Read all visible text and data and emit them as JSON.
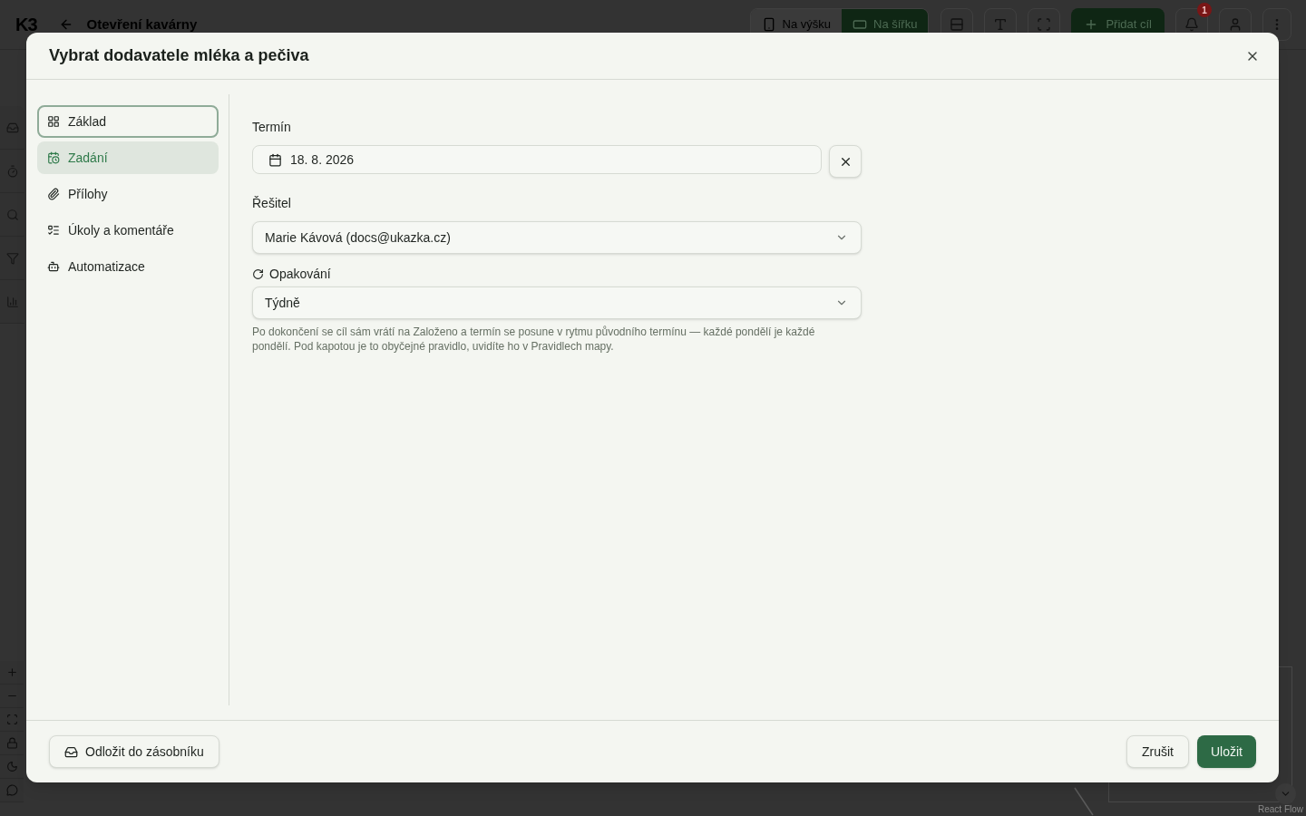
{
  "app": {
    "logo": "K3",
    "title": "Otevření kavárny",
    "orientation": [
      {
        "label": "Na výšku",
        "kind": "portrait",
        "selected": false
      },
      {
        "label": "Na šířku",
        "kind": "landscape",
        "selected": true
      }
    ],
    "add_button": "Přidat cíl",
    "notification_count": "1",
    "attribution": "React Flow"
  },
  "dialog": {
    "title": "Vybrat dodavatele mléka a pečiva",
    "nav": [
      {
        "label": "Základ",
        "kind": "grid",
        "selected": false,
        "focused": true
      },
      {
        "label": "Zadání",
        "kind": "calendar",
        "selected": true,
        "focused": false
      },
      {
        "label": "Přílohy",
        "kind": "paperclip",
        "selected": false,
        "focused": false
      },
      {
        "label": "Úkoly a komentáře",
        "kind": "checklist",
        "selected": false,
        "focused": false
      },
      {
        "label": "Automatizace",
        "kind": "robot",
        "selected": false,
        "focused": false
      }
    ],
    "deadline": {
      "label": "Termín",
      "value": "18. 8. 2026"
    },
    "assignee": {
      "label": "Řešitel",
      "value": "Marie Kávová (docs@ukazka.cz)"
    },
    "repeat": {
      "label": "Opakování",
      "value": "Týdně",
      "help": "Po dokončení se cíl sám vrátí na Založeno a termín se posune v rytmu původního termínu — každé pondělí je každé pondělí. Pod kapotou je to obyčejné pravidlo, uvidíte ho v Pravidlech mapy."
    },
    "footer": {
      "defer_button": "Odložit do zásobníku",
      "cancel_button": "Zrušit",
      "save_button": "Uložit"
    }
  }
}
